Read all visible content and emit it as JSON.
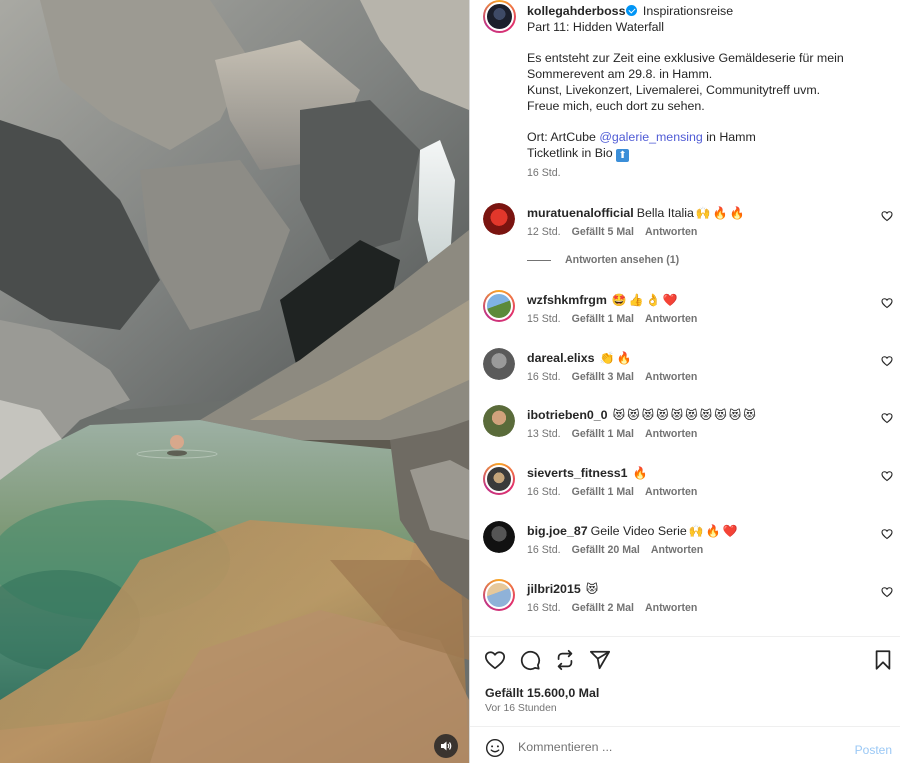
{
  "post": {
    "author": "kollegahderboss",
    "verified": true,
    "title_tag": "Inspirationsreise",
    "caption": {
      "line1": "Part 11: Hidden Waterfall",
      "para1": [
        "Es entsteht zur Zeit eine exklusive Gemäldeserie für mein",
        "Sommerevent am 29.8. in Hamm.",
        "Kunst, Livekonzert, Livemalerei, Communitytreff uvm.",
        "Freue mich, euch dort zu sehen."
      ],
      "ort_prefix": "Ort: ArtCube ",
      "ort_mention": "@galerie_mensing",
      "ort_suffix": " in Hamm",
      "ticket": "Ticketlink in Bio",
      "ticket_emoji": "⬆"
    },
    "time": "16 Std."
  },
  "comments": [
    {
      "user": "muratuenalofficial",
      "text": "Bella Italia",
      "emojis": [
        "🙌",
        "🔥",
        "🔥"
      ],
      "time": "12 Std.",
      "likes": "Gefällt 5 Mal",
      "reply": "Antworten"
    },
    {
      "user": "wzfshkmfrgm",
      "text": "",
      "emojis": [
        "🤩",
        "👍",
        "👌",
        "❤️"
      ],
      "time": "15 Std.",
      "likes": "Gefällt 1 Mal",
      "reply": "Antworten"
    },
    {
      "user": "dareal.elixs",
      "text": "",
      "emojis": [
        "👏",
        "🔥"
      ],
      "time": "16 Std.",
      "likes": "Gefällt 3 Mal",
      "reply": "Antworten"
    },
    {
      "user": "ibotrieben0_0",
      "text": "",
      "emojis": [
        "😻",
        "😻",
        "😻",
        "😻",
        "😻",
        "😻",
        "😻",
        "😻",
        "😻",
        "😻"
      ],
      "time": "13 Std.",
      "likes": "Gefällt 1 Mal",
      "reply": "Antworten"
    },
    {
      "user": "sieverts_fitness1",
      "text": "",
      "emojis": [
        "🔥"
      ],
      "time": "16 Std.",
      "likes": "Gefällt 1 Mal",
      "reply": "Antworten"
    },
    {
      "user": "big.joe_87",
      "text": "Geile Video Serie",
      "emojis": [
        "🙌",
        "🔥",
        "❤️"
      ],
      "time": "16 Std.",
      "likes": "Gefällt 20 Mal",
      "reply": "Antworten"
    },
    {
      "user": "jilbri2015",
      "text": "",
      "emojis": [
        "😻"
      ],
      "time": "16 Std.",
      "likes": "Gefällt 2 Mal",
      "reply": "Antworten"
    }
  ],
  "replies_toggle": "Antworten ansehen (1)",
  "footer": {
    "likes": "Gefällt 15.600,0 Mal",
    "ago": "Vor 16 Stunden",
    "comment_placeholder": "Kommentieren ...",
    "post_button": "Posten"
  },
  "colors": {
    "link": "#4f5bd5",
    "verified": "#0095f6",
    "post_button_disabled": "#9ac8f5",
    "muted": "#737373"
  },
  "icons": [
    "heart-icon",
    "comment-icon",
    "repost-icon",
    "share-icon",
    "bookmark-icon",
    "smiley-icon",
    "sound-icon",
    "verified-icon"
  ]
}
